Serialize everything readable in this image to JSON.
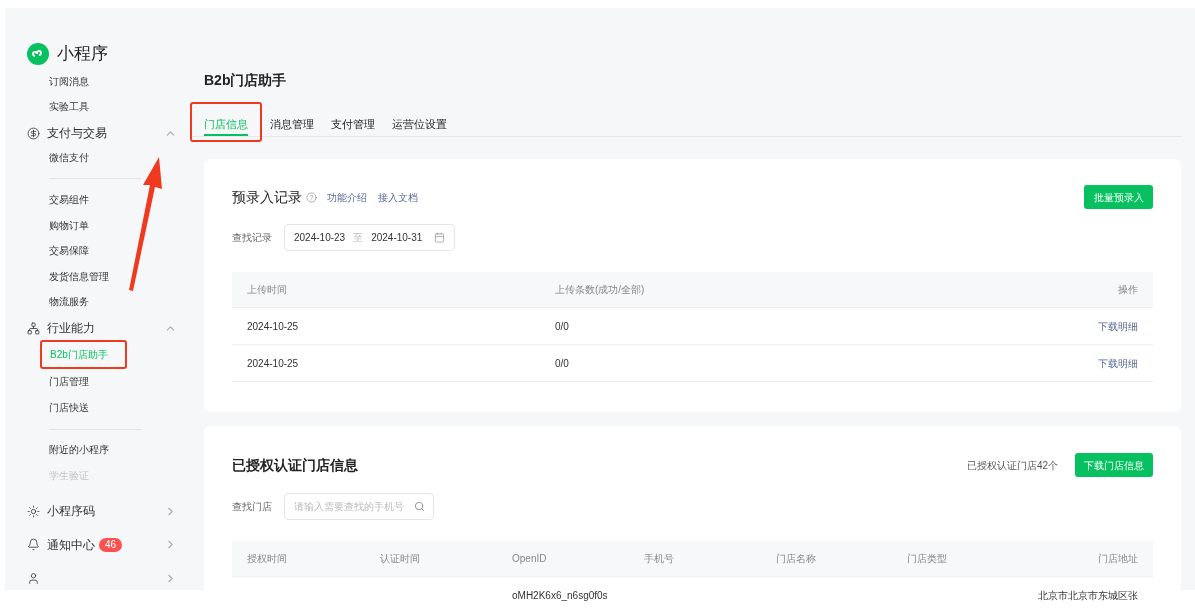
{
  "sidebar": {
    "title": "小程序",
    "items": [
      {
        "kind": "item",
        "label": "订阅消息",
        "selected": false,
        "disabled": false,
        "highlighted": false
      },
      {
        "kind": "item",
        "label": "实验工具",
        "selected": false,
        "disabled": false,
        "highlighted": false
      },
      {
        "kind": "group",
        "label": "支付与交易",
        "expanded": true
      },
      {
        "kind": "item",
        "label": "微信支付",
        "selected": false,
        "disabled": false,
        "highlighted": false
      },
      {
        "kind": "divider"
      },
      {
        "kind": "item",
        "label": "交易组件",
        "selected": false,
        "disabled": false,
        "highlighted": false
      },
      {
        "kind": "item",
        "label": "购物订单",
        "selected": false,
        "disabled": false,
        "highlighted": false
      },
      {
        "kind": "item",
        "label": "交易保障",
        "selected": false,
        "disabled": false,
        "highlighted": false
      },
      {
        "kind": "item",
        "label": "发货信息管理",
        "selected": false,
        "disabled": false,
        "highlighted": false
      },
      {
        "kind": "item",
        "label": "物流服务",
        "selected": false,
        "disabled": false,
        "highlighted": false
      },
      {
        "kind": "group",
        "label": "行业能力",
        "expanded": true
      },
      {
        "kind": "item",
        "label": "B2b门店助手",
        "selected": true,
        "disabled": false,
        "highlighted": true
      },
      {
        "kind": "item",
        "label": "门店管理",
        "selected": false,
        "disabled": false,
        "highlighted": false
      },
      {
        "kind": "item",
        "label": "门店快送",
        "selected": false,
        "disabled": false,
        "highlighted": false
      },
      {
        "kind": "divider"
      },
      {
        "kind": "item",
        "label": "附近的小程序",
        "selected": false,
        "disabled": false,
        "highlighted": false
      },
      {
        "kind": "item",
        "label": "学生验证",
        "selected": false,
        "disabled": true,
        "highlighted": false
      },
      {
        "kind": "group",
        "label": "小程序码",
        "expanded": false
      },
      {
        "kind": "group",
        "label": "通知中心",
        "expanded": false,
        "badge": "46"
      },
      {
        "kind": "group",
        "expanded": false
      }
    ]
  },
  "page_title": "B2b门店助手",
  "tabs": [
    {
      "label": "门店信息",
      "selected": true,
      "highlighted": true
    },
    {
      "label": "消息管理",
      "selected": false,
      "highlighted": false
    },
    {
      "label": "支付管理",
      "selected": false,
      "highlighted": false
    },
    {
      "label": "运营位设置",
      "selected": false,
      "highlighted": false
    }
  ],
  "pre_records": {
    "title": "预录入记录",
    "links": [
      "功能介绍",
      "接入文档"
    ],
    "button": "批量预录入",
    "filter_label": "查找记录",
    "date_from": "2024-10-23",
    "date_sep": "至",
    "date_to": "2024-10-31",
    "table": {
      "columns": [
        "上传时间",
        "上传条数(成功/全部)",
        "操作"
      ],
      "rows": [
        {
          "cells": [
            "2024-10-25",
            "0/0"
          ],
          "action": "下载明细"
        },
        {
          "cells": [
            "2024-10-25",
            "0/0"
          ],
          "action": "下载明细"
        }
      ]
    }
  },
  "stores": {
    "title": "已授权认证门店信息",
    "count": "已授权认证门店42个",
    "button": "下载门店信息",
    "filter_label": "查找门店",
    "search_placeholder": "请输入需要查找的手机号",
    "table": {
      "columns": [
        "授权时间",
        "认证时间",
        "OpenID",
        "手机号",
        "门店名称",
        "门店类型",
        "门店地址"
      ],
      "rows": [
        {
          "cells": [
            "",
            "",
            "oMH2K6x6_n6sg0f0s",
            "",
            "",
            "",
            "北京市北京市东城区张"
          ]
        }
      ]
    }
  }
}
